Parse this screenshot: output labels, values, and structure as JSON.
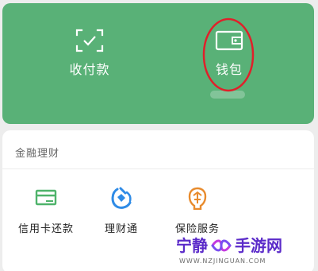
{
  "top_card": {
    "pay": {
      "label": "收付款",
      "icon": "scan-check-icon"
    },
    "wallet": {
      "label": "钱包",
      "icon": "wallet-icon"
    }
  },
  "finance": {
    "title": "金融理财",
    "items": [
      {
        "label": "信用卡还款",
        "icon": "credit-card-icon"
      },
      {
        "label": "理财通",
        "icon": "wealth-icon"
      },
      {
        "label": "保险服务",
        "icon": "insurance-icon"
      }
    ]
  },
  "watermark": {
    "left": "宁静",
    "right": "手游网",
    "url": "WWW.NZJINGUAN.COM"
  },
  "colors": {
    "green": "#59b177",
    "highlight": "#e0202a",
    "credit_green": "#4fb36b",
    "wealth_blue": "#2f8be6",
    "insurance_orange": "#e88b2d",
    "watermark_purple": "#5b2bc9"
  }
}
